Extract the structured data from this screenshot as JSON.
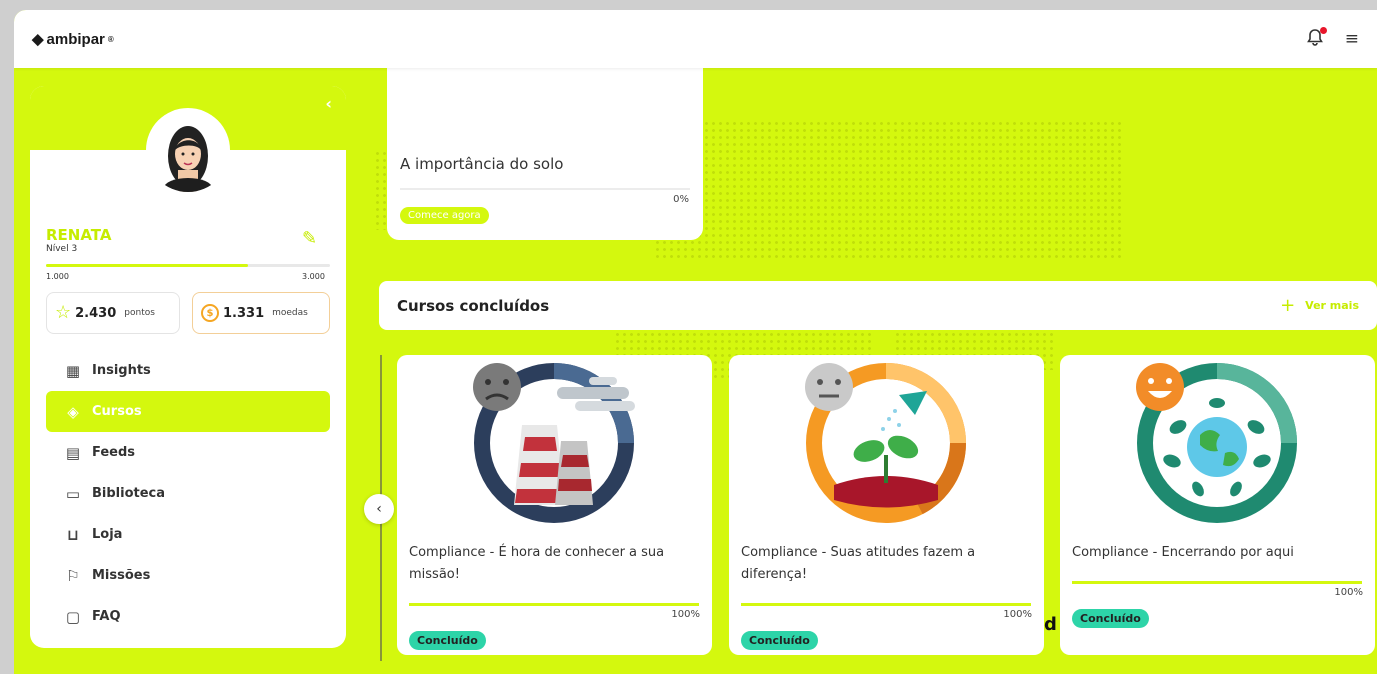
{
  "brand": {
    "logo": "ambipar",
    "sup": "®"
  },
  "topbar": {
    "bell_icon": "bell-icon",
    "menu_icon": "hamburger-icon"
  },
  "profile": {
    "name": "RENATA",
    "level": "Nível 3",
    "xp_min": "1.000",
    "xp_max": "3.000",
    "xp_progress": 0.71,
    "points": "2.430",
    "points_label": "pontos",
    "coins": "1.331",
    "coins_label": "moedas",
    "coin_symbol": "$"
  },
  "menu": [
    {
      "label": "Insights",
      "icon": "grid-icon"
    },
    {
      "label": "Cursos",
      "icon": "layers-icon",
      "active": true
    },
    {
      "label": "Feeds",
      "icon": "news-icon"
    },
    {
      "label": "Biblioteca",
      "icon": "book-icon"
    },
    {
      "label": "Loja",
      "icon": "cart-icon"
    },
    {
      "label": "Missões",
      "icon": "flag-icon"
    },
    {
      "label": "FAQ",
      "icon": "chat-icon"
    }
  ],
  "current_course": {
    "title": "A importância do solo",
    "progress": "0%",
    "cta": "Comece agora"
  },
  "completed": {
    "heading": "Cursos concluídos",
    "see_more": "Ver mais",
    "cards": [
      {
        "title": "Compliance - É hora de conhecer a sua missão!",
        "progress": "100%",
        "badge": "Concluído"
      },
      {
        "title": "Compliance - Suas atitudes fazem a diferença!",
        "progress": "100%",
        "badge": "Concluído"
      },
      {
        "title": "Compliance - Encerrando por aqui",
        "progress": "100%",
        "badge": "Concluído"
      }
    ]
  },
  "stray_text": "d",
  "colors": {
    "accent": "#d4f80e",
    "badge": "#2dd4a8",
    "coin": "#f5a623",
    "alert": "#e8162b"
  }
}
